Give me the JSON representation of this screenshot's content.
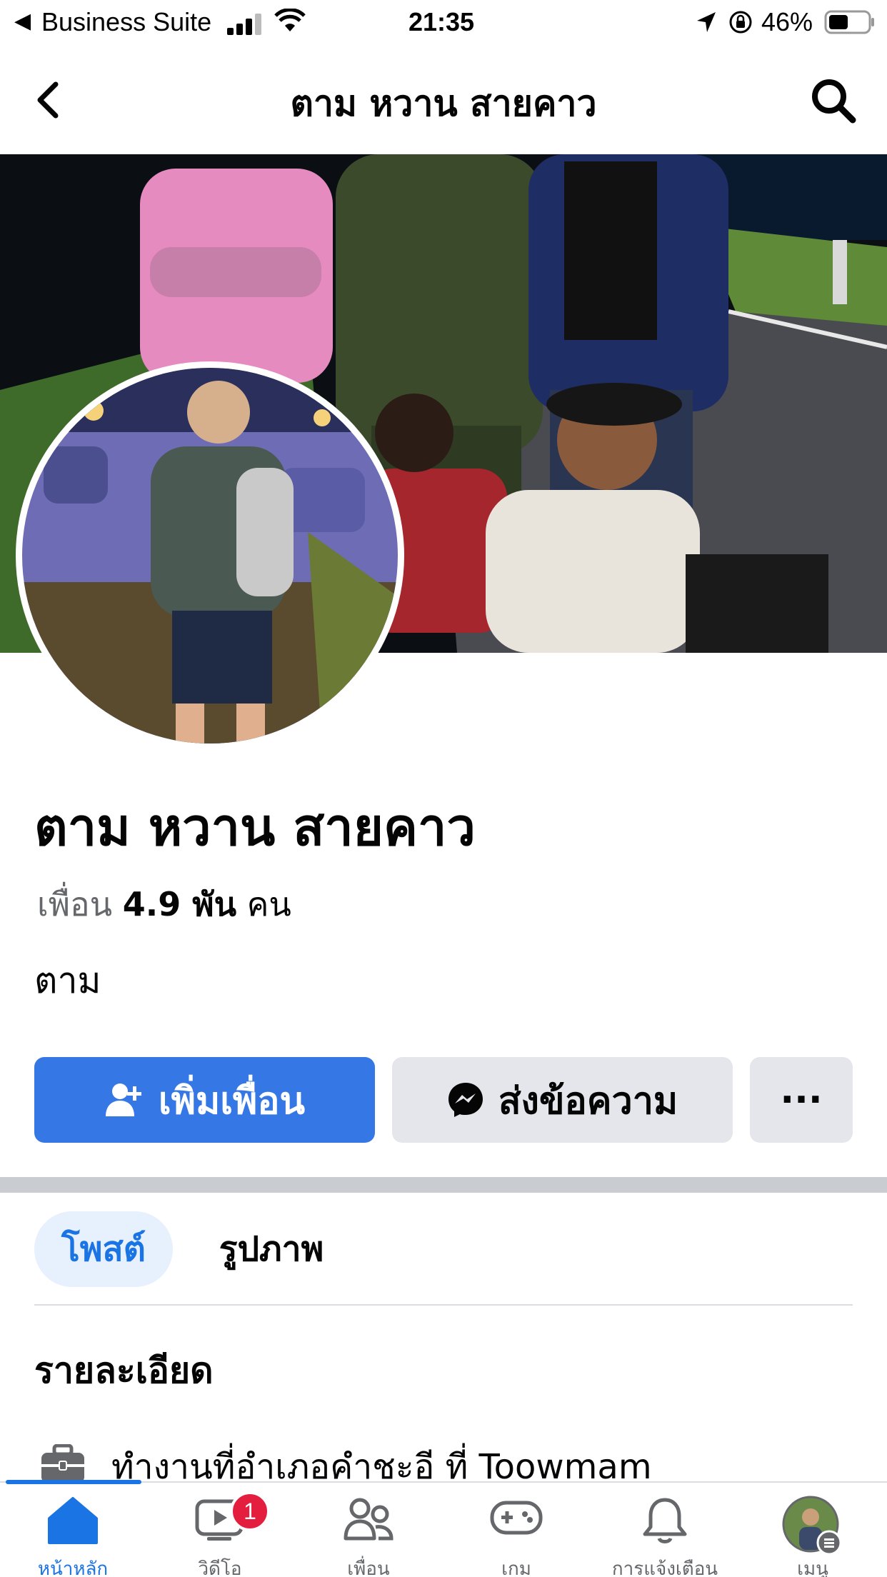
{
  "status_bar": {
    "carrier": "Business Suite",
    "time": "21:35",
    "battery": "46%"
  },
  "header": {
    "title": "ตาม หวาน สายคาว"
  },
  "profile": {
    "name": "ตาม หวาน สายคาว",
    "friends_prefix": "เพื่อน",
    "friends_count": "4.9 พัน",
    "friends_suffix": "คน",
    "bio": "ตาม"
  },
  "actions": {
    "add_friend": "เพิ่มเพื่อน",
    "message": "ส่งข้อความ",
    "more": "···"
  },
  "tabs": [
    {
      "label": "โพสต์",
      "active": true
    },
    {
      "label": "รูปภาพ",
      "active": false
    }
  ],
  "details": {
    "heading": "รายละเอียด",
    "work": "ทำงานที่อำเภอคำชะอี ที่ Toowmam"
  },
  "bottom_nav": [
    {
      "label": "หน้าหลัก",
      "icon": "home-icon",
      "active": true
    },
    {
      "label": "วิดีโอ",
      "icon": "video-icon",
      "badge": "1"
    },
    {
      "label": "เพื่อน",
      "icon": "friends-icon"
    },
    {
      "label": "เกม",
      "icon": "gaming-icon"
    },
    {
      "label": "การแจ้งเตือน",
      "icon": "bell-icon"
    },
    {
      "label": "เมนู",
      "icon": "menu-avatar-icon"
    }
  ],
  "colors": {
    "primary": "#3578e5",
    "accent_text": "#1b74e4",
    "secondary_button": "#e4e6eb",
    "badge": "#e41e3f"
  }
}
